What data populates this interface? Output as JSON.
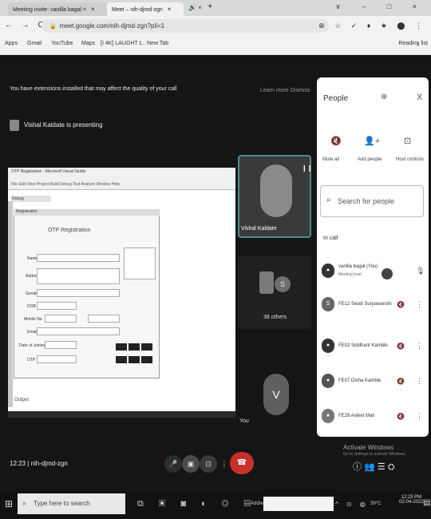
{
  "browser": {
    "tabs": [
      {
        "label": "Meeting invite: vanilla bagal <",
        "close": "×"
      },
      {
        "label": "Meet – nih-djmd-zgn",
        "close": "×"
      }
    ],
    "extra_tab_icons": "🔊 ×",
    "new_tab": "+",
    "window_controls": "∨ – □ ×",
    "nav": "← → C ⌂",
    "url": "meet.google.com/nih-djmd-zgn?pli=1",
    "extension_icons": "⊕ ☆ ✓ ♦ ★ ⬤ ⋮",
    "bookmarks": [
      {
        "label": "Apps"
      },
      {
        "label": "Gmail"
      },
      {
        "label": "YouTube"
      },
      {
        "label": "Maps"
      },
      {
        "label": "[I 4K] LAUGHT L.."
      },
      {
        "label": "New Tab"
      }
    ],
    "reading_list": "Reading list"
  },
  "meet": {
    "warning": "You have extensions installed that may affect the quality of your call",
    "learn_more": "Learn more",
    "dismiss": "Dismiss",
    "presenting": "Vishal Kaldate is presenting",
    "meeting_code": "12:23  |  nih-djmd-zgn",
    "shared_screen": {
      "title": "OTP Registration - Microsoft Visual Studio",
      "menu": "File  Edit  View  Project  Build  Debug  Test  Analyze  Window  Help",
      "toolbar_field": "Debug",
      "form_header": "Registration",
      "form_title": "OTP Registration",
      "labels": [
        "Name",
        "Address",
        "Gender",
        "DOB",
        "Mobile No.",
        "Email",
        "Date of Joining",
        "OTP"
      ],
      "bottom_text": "Output",
      "caption": "You"
    },
    "tiles": [
      {
        "name": "Vishal Kaldate",
        "mic": "❙❙"
      },
      {
        "name": "38 others",
        "initial": "S"
      },
      {
        "initial": "V"
      }
    ],
    "controls": {
      "mic": "🎤",
      "cam": "▣",
      "present": "⊡",
      "more": "⋮",
      "end": "☎"
    },
    "activate": "Activate Windows",
    "activate_sub": "Go to Settings to activate Windows.",
    "right_controls": "ⓘ  👥  ☰  ⛭"
  },
  "people_panel": {
    "title": "People",
    "add_icon": "⊕",
    "close": "X",
    "actions": [
      {
        "icon": "🔇",
        "label": "Mute all"
      },
      {
        "icon": "👤+",
        "label": "Add people"
      },
      {
        "icon": "⊡",
        "label": "Host controls"
      }
    ],
    "search_placeholder": "Search for people",
    "in_call_label": "In call",
    "participants": [
      {
        "name": "vanilla bagal (You)",
        "sub": "Meeting host",
        "avatar": "●",
        "mic": "🎙"
      },
      {
        "name": "FE12 Swati Suryawanshi",
        "avatar": "S",
        "mic": "🔇",
        "more": "⋮"
      },
      {
        "name": "FE02 Siddhant Kamble",
        "avatar": "●",
        "mic": "🔇",
        "more": "⋮"
      },
      {
        "name": "FE07 Disha Kamble",
        "avatar": "●",
        "mic": "🔇",
        "more": "⋮"
      },
      {
        "name": "FE28 Aniket Mali",
        "avatar": "●",
        "mic": "🔇",
        "more": "⋮"
      }
    ]
  },
  "taskbar": {
    "start": "⊞",
    "search_placeholder": "Type here to search",
    "search_icon": "⌕",
    "app_icons": "⧉ ▣ ◙ ◐ ◎ ▤",
    "address_label": "Address",
    "tray": "^ ⊙ ◍",
    "temp": "39°C",
    "clock": "12:23 PM\n02-04-2022",
    "notifications": "▤"
  }
}
